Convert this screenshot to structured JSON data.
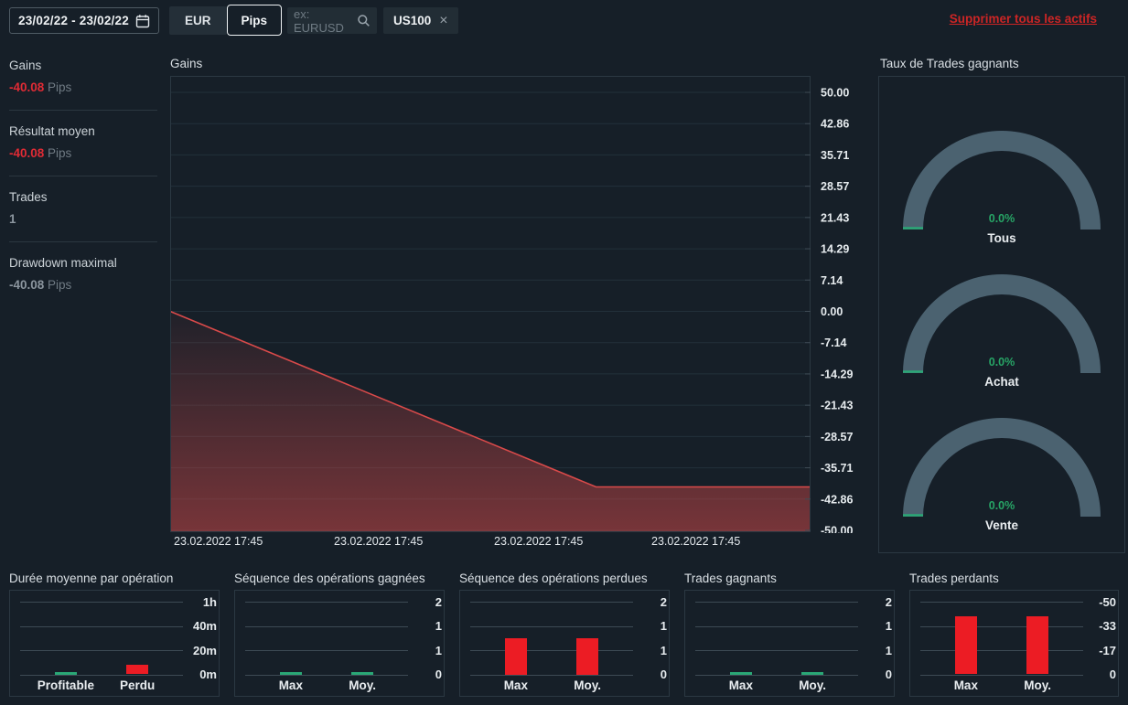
{
  "topbar": {
    "date_range": "23/02/22 - 23/02/22",
    "currency_button": "EUR",
    "pips_button": "Pips",
    "search_placeholder": "ex: EURUSD",
    "asset_tag": "US100",
    "asset_tag_remove": "×",
    "clear_link": "Supprimer tous les actifs"
  },
  "stats": [
    {
      "label": "Gains",
      "value": "-40.08",
      "unit": "Pips",
      "value_color": "#e02b35"
    },
    {
      "label": "Résultat moyen",
      "value": "-40.08",
      "unit": "Pips",
      "value_color": "#e02b35"
    },
    {
      "label": "Trades",
      "value": "1",
      "unit": "",
      "value_color": "#8b959e"
    },
    {
      "label": "Drawdown maximal",
      "value": "-40.08",
      "unit": "Pips",
      "value_color": "#8b959e"
    }
  ],
  "colors": {
    "background": "#161f28",
    "panel_border": "#2b3842",
    "red": "#ec1c24",
    "green": "#2aa876",
    "line_red": "#d94a4a",
    "gauge_arc": "#4b6270",
    "gauge_value_green": "#27a566",
    "link_red": "#cc2525"
  },
  "chart_data": [
    {
      "type": "area",
      "title": "Gains",
      "ylim": [
        -50,
        50
      ],
      "grid": true,
      "yticks": [
        "50.00",
        "42.86",
        "35.71",
        "28.57",
        "21.43",
        "14.29",
        "7.14",
        "0.00",
        "-7.14",
        "-14.29",
        "-21.43",
        "-28.57",
        "-35.71",
        "-42.86",
        "-50.00"
      ],
      "xticks": [
        "23.02.2022 17:45",
        "23.02.2022 17:45",
        "23.02.2022 17:45",
        "23.02.2022 17:45"
      ],
      "series": [
        {
          "name": "Gains",
          "color": "#d94a4a",
          "points": [
            {
              "x": 0,
              "y": 0.0
            },
            {
              "x": 0.665,
              "y": -40.08
            },
            {
              "x": 1,
              "y": -40.08
            }
          ]
        }
      ]
    },
    {
      "type": "gauge",
      "title": "Taux de Trades gagnants",
      "gauges": [
        {
          "label": "Tous",
          "value": "0.0%",
          "percent": 0
        },
        {
          "label": "Achat",
          "value": "0.0%",
          "percent": 0
        },
        {
          "label": "Vente",
          "value": "0.0%",
          "percent": 0
        }
      ]
    },
    {
      "type": "bar",
      "title": "Durée moyenne par opération",
      "yticks": [
        "1h",
        "40m",
        "20m",
        "0m"
      ],
      "ymax": 60,
      "bars": [
        {
          "label": "Profitable",
          "value": 0,
          "color": "green"
        },
        {
          "label": "Perdu",
          "value": 8,
          "color": "red"
        }
      ]
    },
    {
      "type": "bar",
      "title": "Séquence des opérations gagnées",
      "yticks": [
        "2",
        "1",
        "1",
        "0"
      ],
      "ymax": 2,
      "bars": [
        {
          "label": "Max",
          "value": 0,
          "color": "green"
        },
        {
          "label": "Moy.",
          "value": 0,
          "color": "green"
        }
      ]
    },
    {
      "type": "bar",
      "title": "Séquence des opérations perdues",
      "yticks": [
        "2",
        "1",
        "1",
        "0"
      ],
      "ymax": 2,
      "bars": [
        {
          "label": "Max",
          "value": 1,
          "color": "red"
        },
        {
          "label": "Moy.",
          "value": 1,
          "color": "red"
        }
      ]
    },
    {
      "type": "bar",
      "title": "Trades gagnants",
      "yticks": [
        "2",
        "1",
        "1",
        "0"
      ],
      "ymax": 2,
      "bars": [
        {
          "label": "Max",
          "value": 0,
          "color": "green"
        },
        {
          "label": "Moy.",
          "value": 0,
          "color": "green"
        }
      ]
    },
    {
      "type": "bar",
      "title": "Trades perdants",
      "yticks": [
        "-50",
        "-33",
        "-17",
        "0"
      ],
      "ymax": 50,
      "bars": [
        {
          "label": "Max",
          "value": -40.08,
          "color": "red"
        },
        {
          "label": "Moy.",
          "value": -40.08,
          "color": "red"
        }
      ]
    }
  ]
}
